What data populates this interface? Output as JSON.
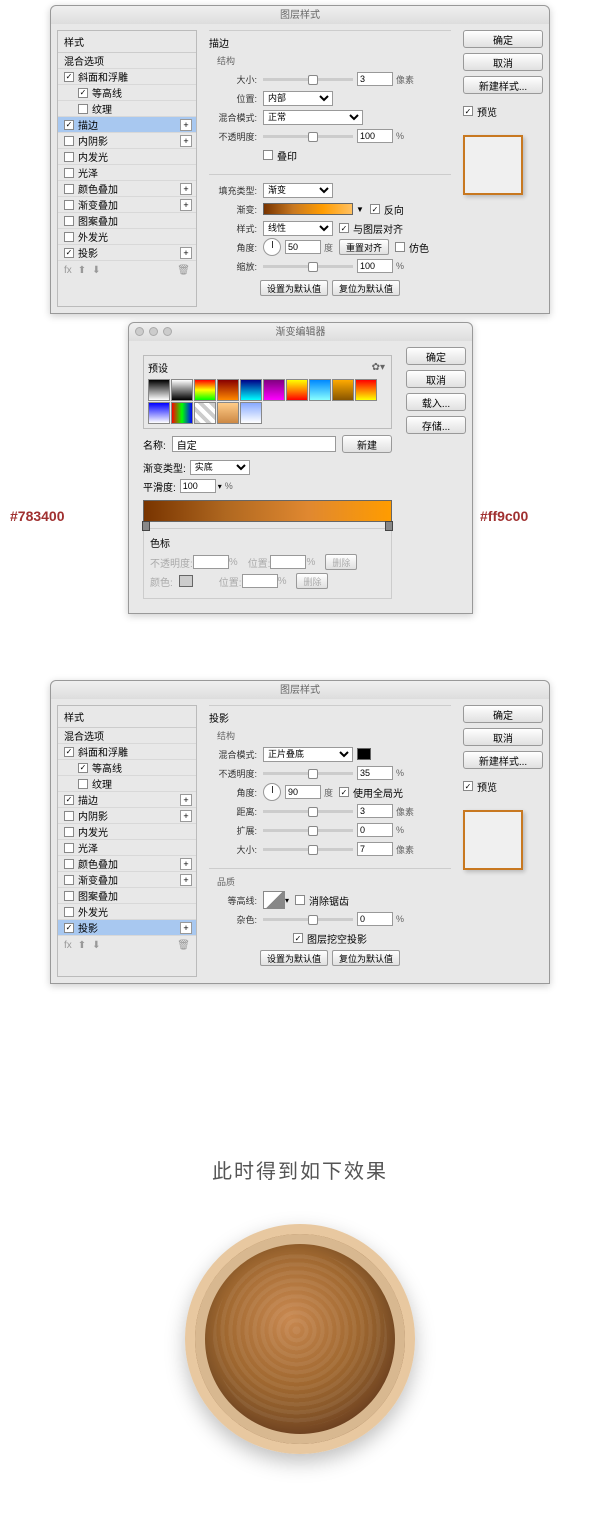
{
  "dialog1": {
    "title": "图层样式",
    "styles_header": "样式",
    "rows": [
      {
        "label": "混合选项",
        "sel": false,
        "checked": null,
        "plus": false
      },
      {
        "label": "斜面和浮雕",
        "sel": false,
        "checked": true,
        "plus": false
      },
      {
        "label": "等高线",
        "sel": false,
        "checked": true,
        "plus": false,
        "sub": true
      },
      {
        "label": "纹理",
        "sel": false,
        "checked": false,
        "plus": false,
        "sub": true
      },
      {
        "label": "描边",
        "sel": true,
        "checked": true,
        "plus": true
      },
      {
        "label": "内阴影",
        "sel": false,
        "checked": false,
        "plus": true
      },
      {
        "label": "内发光",
        "sel": false,
        "checked": false,
        "plus": false
      },
      {
        "label": "光泽",
        "sel": false,
        "checked": false,
        "plus": false
      },
      {
        "label": "颜色叠加",
        "sel": false,
        "checked": false,
        "plus": true
      },
      {
        "label": "渐变叠加",
        "sel": false,
        "checked": false,
        "plus": true
      },
      {
        "label": "图案叠加",
        "sel": false,
        "checked": false,
        "plus": false
      },
      {
        "label": "外发光",
        "sel": false,
        "checked": false,
        "plus": false
      },
      {
        "label": "投影",
        "sel": false,
        "checked": true,
        "plus": true
      }
    ],
    "section_title": "描边",
    "structure": "结构",
    "size_label": "大小:",
    "size_val": "3",
    "size_unit": "像素",
    "position_label": "位置:",
    "position_val": "内部",
    "blend_label": "混合模式:",
    "blend_val": "正常",
    "opacity_label": "不透明度:",
    "opacity_val": "100",
    "opacity_unit": "%",
    "overprint_label": "叠印",
    "fill_type_label": "填充类型:",
    "fill_type_val": "渐变",
    "gradient_label": "渐变:",
    "reverse_label": "反向",
    "style_label": "样式:",
    "style_val": "线性",
    "align_label": "与图层对齐",
    "angle_label": "角度:",
    "angle_val": "50",
    "angle_unit": "度",
    "reset_align": "重置对齐",
    "dither_label": "仿色",
    "scale_label": "缩放:",
    "scale_val": "100",
    "scale_unit": "%",
    "make_default": "设置为默认值",
    "reset_default": "复位为默认值",
    "ok": "确定",
    "cancel": "取消",
    "new_style": "新建样式...",
    "preview": "预览",
    "fx": "fx"
  },
  "ge": {
    "title": "渐变编辑器",
    "presets": "预设",
    "name_label": "名称:",
    "name_val": "自定",
    "new_btn": "新建",
    "grad_type_label": "渐变类型:",
    "grad_type_val": "实底",
    "smooth_label": "平滑度:",
    "smooth_val": "100",
    "smooth_unit": "%",
    "color_stops": "色标",
    "opacity_label": "不透明度:",
    "opacity_unit": "%",
    "pos_label": "位置:",
    "pos_unit": "%",
    "delete": "删除",
    "color_label": "颜色:",
    "ok": "确定",
    "cancel": "取消",
    "load": "载入...",
    "save": "存储..."
  },
  "hex_left": "#783400",
  "hex_right": "#ff9c00",
  "dialog2": {
    "title": "图层样式",
    "styles_header": "样式",
    "rows": [
      {
        "label": "混合选项",
        "sel": false,
        "checked": null,
        "plus": false
      },
      {
        "label": "斜面和浮雕",
        "sel": false,
        "checked": true,
        "plus": false
      },
      {
        "label": "等高线",
        "sel": false,
        "checked": true,
        "plus": false,
        "sub": true
      },
      {
        "label": "纹理",
        "sel": false,
        "checked": false,
        "plus": false,
        "sub": true
      },
      {
        "label": "描边",
        "sel": false,
        "checked": true,
        "plus": true
      },
      {
        "label": "内阴影",
        "sel": false,
        "checked": false,
        "plus": true
      },
      {
        "label": "内发光",
        "sel": false,
        "checked": false,
        "plus": false
      },
      {
        "label": "光泽",
        "sel": false,
        "checked": false,
        "plus": false
      },
      {
        "label": "颜色叠加",
        "sel": false,
        "checked": false,
        "plus": true
      },
      {
        "label": "渐变叠加",
        "sel": false,
        "checked": false,
        "plus": true
      },
      {
        "label": "图案叠加",
        "sel": false,
        "checked": false,
        "plus": false
      },
      {
        "label": "外发光",
        "sel": false,
        "checked": false,
        "plus": false
      },
      {
        "label": "投影",
        "sel": true,
        "checked": true,
        "plus": true
      }
    ],
    "section_title": "投影",
    "structure": "结构",
    "blend_label": "混合模式:",
    "blend_val": "正片叠底",
    "opacity_label": "不透明度:",
    "opacity_val": "35",
    "opacity_unit": "%",
    "angle_label": "角度:",
    "angle_val": "90",
    "angle_unit": "度",
    "global_light": "使用全局光",
    "distance_label": "距离:",
    "distance_val": "3",
    "distance_unit": "像素",
    "spread_label": "扩展:",
    "spread_val": "0",
    "spread_unit": "%",
    "size_label": "大小:",
    "size_val": "7",
    "size_unit": "像素",
    "quality": "品质",
    "contour_label": "等高线:",
    "anti_alias": "消除锯齿",
    "noise_label": "杂色:",
    "noise_val": "0",
    "noise_unit": "%",
    "knockout": "图层挖空投影",
    "make_default": "设置为默认值",
    "reset_default": "复位为默认值",
    "ok": "确定",
    "cancel": "取消",
    "new_style": "新建样式...",
    "preview": "预览",
    "fx": "fx"
  },
  "caption": "此时得到如下效果"
}
